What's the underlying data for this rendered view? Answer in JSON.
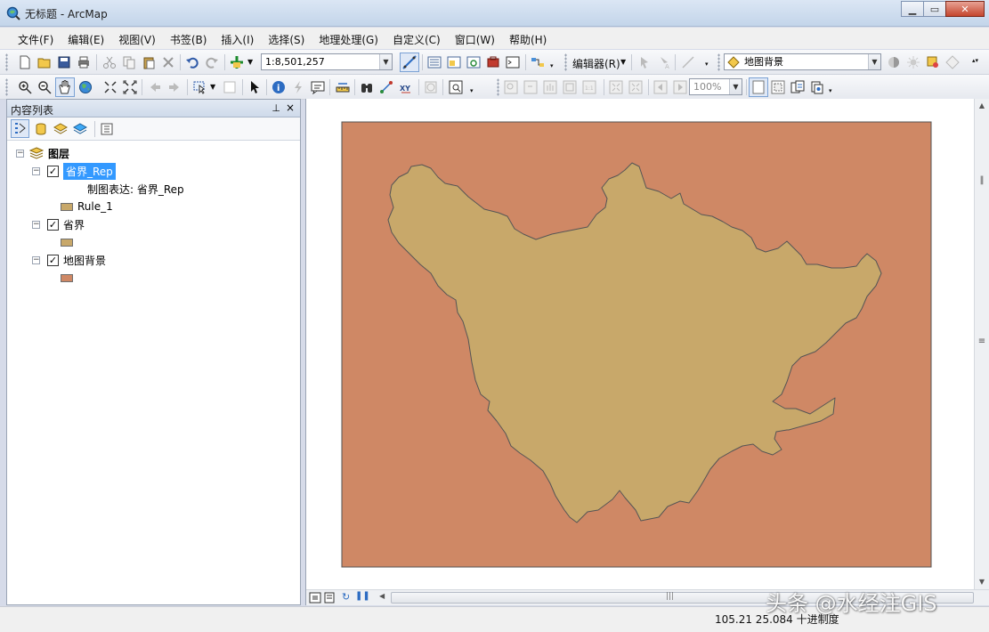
{
  "window": {
    "title": "无标题 - ArcMap"
  },
  "menu": [
    "文件(F)",
    "编辑(E)",
    "视图(V)",
    "书签(B)",
    "插入(I)",
    "选择(S)",
    "地理处理(G)",
    "自定义(C)",
    "窗口(W)",
    "帮助(H)"
  ],
  "toolbar": {
    "scale": "1:8,501,257",
    "editor_label": "编辑器(R)",
    "target_layer": "地图背景",
    "zoom_percent": "100%"
  },
  "toc": {
    "title": "内容列表",
    "root": "图层",
    "layers": [
      {
        "name": "省界_Rep",
        "selected": true,
        "checked": true,
        "sublabel": "制图表达: 省界_Rep",
        "rule": "Rule_1",
        "swatch": "#c8a86a"
      },
      {
        "name": "省界",
        "selected": false,
        "checked": true,
        "swatch": "#c8a86a"
      },
      {
        "name": "地图背景",
        "selected": false,
        "checked": true,
        "swatch": "#cf8865"
      }
    ]
  },
  "map": {
    "background_color": "#cf8865",
    "province_color": "#c8a86a"
  },
  "status": {
    "coords": "105.21  25.084 十进制度"
  },
  "watermark": "头条 @水经注GIS"
}
